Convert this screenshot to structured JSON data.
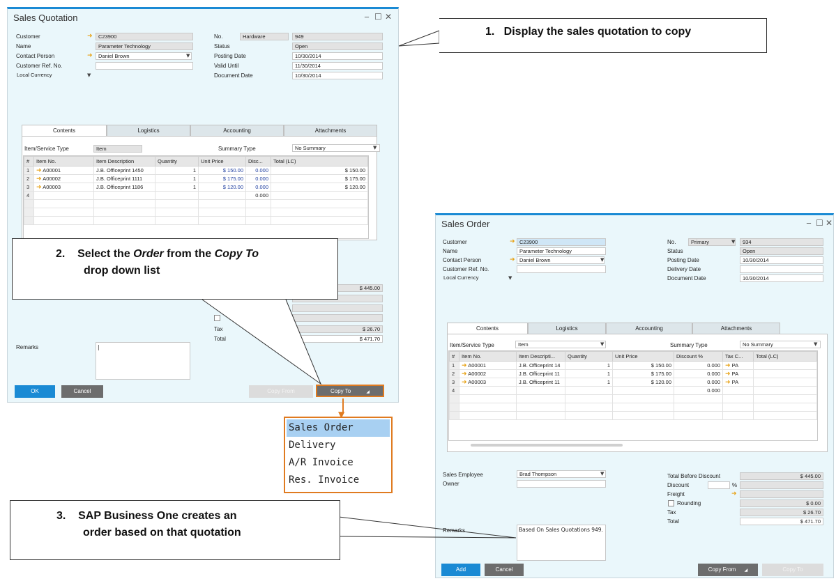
{
  "quotation": {
    "title": "Sales Quotation",
    "controls": {
      "minimize": "_",
      "maximize": "☐",
      "close": "✕"
    },
    "header_left": [
      {
        "label": "Customer",
        "value": "C23900",
        "arrow": true
      },
      {
        "label": "Name",
        "value": "Parameter Technology"
      },
      {
        "label": "Contact Person",
        "value": "Daniel Brown",
        "arrow": true
      },
      {
        "label": "Customer Ref. No.",
        "value": ""
      }
    ],
    "currency": "Local Currency",
    "header_right": [
      {
        "label": "No.",
        "series": "Hardware",
        "value": "949"
      },
      {
        "label": "Status",
        "value": "Open"
      },
      {
        "label": "Posting Date",
        "value": "10/30/2014"
      },
      {
        "label": "Valid Until",
        "value": "11/30/2014"
      },
      {
        "label": "Document Date",
        "value": "10/30/2014"
      }
    ],
    "tabs": [
      "Contents",
      "Logistics",
      "Accounting",
      "Attachments"
    ],
    "item_type_label": "Item/Service Type",
    "item_type_value": "Item",
    "summary_label": "Summary Type",
    "summary_value": "No Summary",
    "columns": [
      "#",
      "Item No.",
      "Item Description",
      "Quantity",
      "Unit Price",
      "Disc...",
      "Total (LC)"
    ],
    "rows": [
      [
        "1",
        "A00001",
        "J.B. Officeprint 1450",
        "1",
        "$ 150.00",
        "0.000",
        "$ 150.00"
      ],
      [
        "2",
        "A00002",
        "J.B. Officeprint 1111",
        "1",
        "$ 175.00",
        "0.000",
        "$ 175.00"
      ],
      [
        "3",
        "A00003",
        "J.B. Officeprint 1186",
        "1",
        "$ 120.00",
        "0.000",
        "$ 120.00"
      ],
      [
        "4",
        "",
        "",
        "",
        "",
        "0.000",
        ""
      ]
    ],
    "totals": {
      "before": "$ 445.00",
      "tax_label": "Tax",
      "tax": "$ 26.70",
      "total_label": "Total",
      "total": "$ 471.70"
    },
    "remarks_label": "Remarks",
    "buttons": {
      "ok": "OK",
      "cancel": "Cancel",
      "copy_from": "Copy From",
      "copy_to": "Copy To"
    }
  },
  "copy_to_menu": [
    "Sales Order",
    "Delivery",
    "A/R Invoice",
    "Res. Invoice"
  ],
  "order": {
    "title": "Sales Order",
    "controls": {
      "minimize": "_",
      "maximize": "☐",
      "close": "✕"
    },
    "header_left": [
      {
        "label": "Customer",
        "value": "C23900",
        "arrow": true
      },
      {
        "label": "Name",
        "value": "Parameter Technology"
      },
      {
        "label": "Contact Person",
        "value": "Daniel Brown",
        "arrow": true
      },
      {
        "label": "Customer Ref. No.",
        "value": ""
      }
    ],
    "currency": "Local Currency",
    "header_right": [
      {
        "label": "No.",
        "series": "Primary",
        "value": "934"
      },
      {
        "label": "Status",
        "value": "Open"
      },
      {
        "label": "Posting Date",
        "value": "10/30/2014"
      },
      {
        "label": "Delivery Date",
        "value": ""
      },
      {
        "label": "Document Date",
        "value": "10/30/2014"
      }
    ],
    "tabs": [
      "Contents",
      "Logistics",
      "Accounting",
      "Attachments"
    ],
    "item_type_label": "Item/Service Type",
    "item_type_value": "Item",
    "summary_label": "Summary Type",
    "summary_value": "No Summary",
    "columns": [
      "#",
      "Item No.",
      "Item Descripti...",
      "Quantity",
      "Unit Price",
      "Discount %",
      "Tax C...",
      "Total (LC)"
    ],
    "rows": [
      [
        "1",
        "A00001",
        "J.B. Officeprint 14",
        "1",
        "$ 150.00",
        "0.000",
        "PA",
        ""
      ],
      [
        "2",
        "A00002",
        "J.B. Officeprint 11",
        "1",
        "$ 175.00",
        "0.000",
        "PA",
        ""
      ],
      [
        "3",
        "A00003",
        "J.B. Officeprint 11",
        "1",
        "$ 120.00",
        "0.000",
        "PA",
        ""
      ],
      [
        "4",
        "",
        "",
        "",
        "",
        "0.000",
        "",
        ""
      ]
    ],
    "sales_employee_label": "Sales Employee",
    "sales_employee": "Brad Thompson",
    "owner_label": "Owner",
    "totals": {
      "before_label": "Total Before Discount",
      "before": "$ 445.00",
      "discount_label": "Discount",
      "pct": "%",
      "freight_label": "Freight",
      "rounding_label": "Rounding",
      "rounding": "$ 0.00",
      "tax_label": "Tax",
      "tax": "$ 26.70",
      "total_label": "Total",
      "total": "$ 471.70"
    },
    "remarks_label": "Remarks",
    "remarks": "Based On Sales Quotations 949.",
    "buttons": {
      "add": "Add",
      "cancel": "Cancel",
      "copy_from": "Copy From",
      "copy_to": "Copy To"
    }
  },
  "callouts": {
    "c1": "1.   Display the sales quotation to copy",
    "c2_num": "2.",
    "c2_a": "Select the ",
    "c2_b": "Order",
    "c2_c": " from the ",
    "c2_d": "Copy To",
    "c2_e": "drop down list",
    "c3_num": "3.",
    "c3_a": "SAP Business One creates an",
    "c3_b": "order based on that quotation"
  },
  "colors": {
    "accent": "#e07b20",
    "window_bg": "#eaf7fb",
    "button_blue": "#1a8ad4",
    "link_arrow": "#e8a317"
  }
}
